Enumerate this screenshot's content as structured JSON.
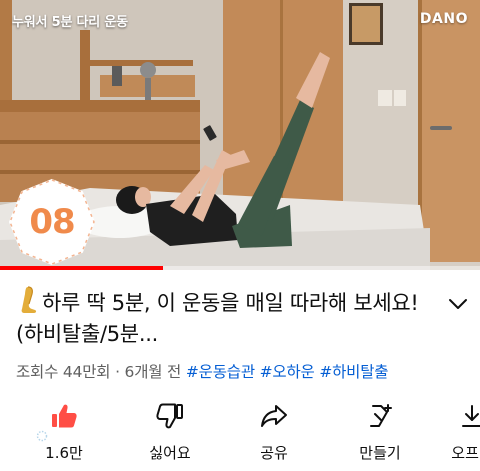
{
  "video": {
    "overlay_title": "누워서 5분 다리 운동",
    "brand": "DANO",
    "counter": "08",
    "progress_fraction": 0.34
  },
  "title": {
    "emoji": "leg-emoji",
    "text": "하루 딱 5분, 이 운동을 매일  따라해 보세요! (하비탈출/5분..."
  },
  "meta": {
    "views": "조회수 44만회",
    "separator": " · ",
    "age": "6개월 전",
    "tags": [
      "#운동습관",
      "#오하운",
      "#하비탈출"
    ]
  },
  "actions": [
    {
      "icon": "thumbs-up-icon",
      "label": "1.6만"
    },
    {
      "icon": "thumbs-down-icon",
      "label": "싫어요"
    },
    {
      "icon": "share-icon",
      "label": "공유"
    },
    {
      "icon": "remix-icon",
      "label": "만들기"
    },
    {
      "icon": "offline-icon",
      "label": "오프라"
    }
  ],
  "colors": {
    "like_active": "#ff4e45",
    "link": "#065fd4",
    "meta_text": "#606060",
    "progress": "#ff0000",
    "counter": "#f08a4b"
  }
}
